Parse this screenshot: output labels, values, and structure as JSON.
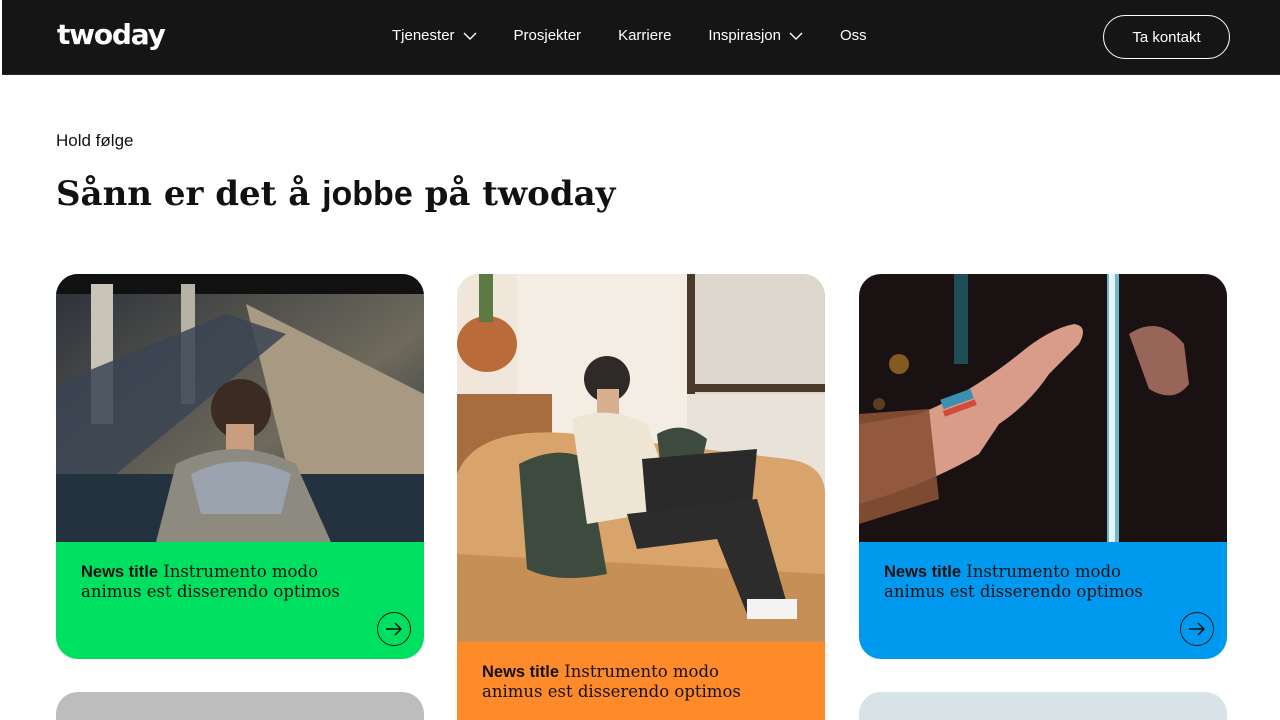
{
  "header": {
    "logo": "twoday",
    "nav": [
      {
        "label": "Tjenester",
        "has_dropdown": true
      },
      {
        "label": "Prosjekter",
        "has_dropdown": false
      },
      {
        "label": "Karriere",
        "has_dropdown": false
      },
      {
        "label": "Inspirasjon",
        "has_dropdown": true
      },
      {
        "label": "Oss",
        "has_dropdown": false
      }
    ],
    "cta": "Ta kontakt"
  },
  "section": {
    "eyebrow": "Hold følge",
    "headline_pre": "Sånn er det å ",
    "headline_bold": "jobbe",
    "headline_post": " på twoday"
  },
  "cards": [
    {
      "title": "News title",
      "body": " Instrumento modo animus est disserendo optimos",
      "color": "#00e060",
      "image": "man-on-escalator-photo",
      "arrow_icon": "arrow-right-circle-icon"
    },
    {
      "title": "News title",
      "body": " Instrumento modo animus est disserendo optimos",
      "color": "#ff8a2a",
      "image": "man-on-sofa-with-laptop-photo",
      "arrow_icon": "arrow-right-circle-icon"
    },
    {
      "title": "News title",
      "body": " Instrumento modo animus est disserendo optimos",
      "color": "#0099f0",
      "image": "hands-touching-reflection-photo",
      "arrow_icon": "arrow-right-circle-icon"
    }
  ],
  "colors": {
    "header_bg": "#151515",
    "text": "#111111"
  }
}
